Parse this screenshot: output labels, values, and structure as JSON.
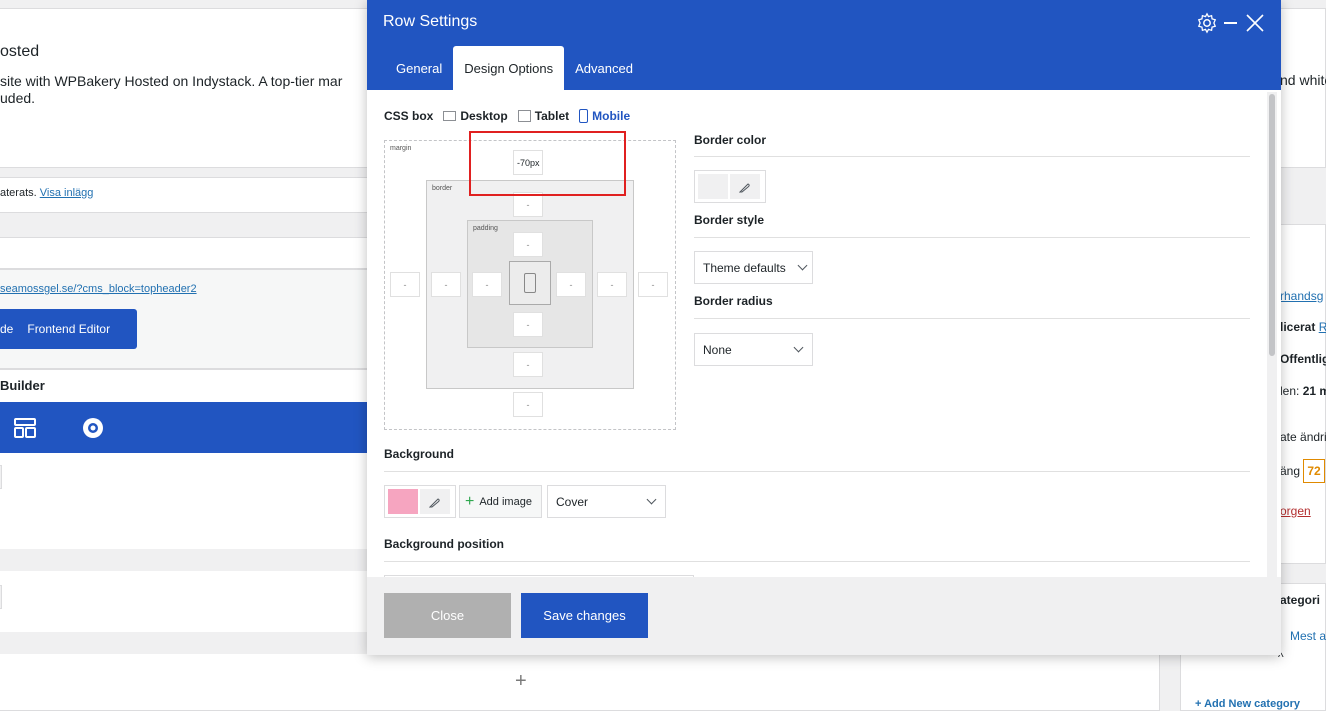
{
  "background": {
    "page_title": "osted",
    "description_line1": "site with WPBakery Hosted on Indystack. A top-tier mar",
    "description_line2": "uded.",
    "notice_text": "aterats.",
    "notice_link": "Visa inlägg",
    "url_link": "seamossgel.se/?cms_block=topheader2",
    "btn_left_label": "de",
    "btn_frontend_label": "Frontend Editor",
    "builder_label": "Builder",
    "add_row_symbol": "+",
    "right_text_top": "nd white",
    "right_items": [
      "rhandsg",
      "licerat",
      "R",
      "Offentlig",
      "len:",
      "21 m",
      "ate ändri",
      "äng",
      "72",
      "orgen",
      "ategori",
      "Mest a",
      "^",
      "+ Add New category"
    ]
  },
  "modal": {
    "title": "Row Settings",
    "tabs": [
      {
        "label": "General"
      },
      {
        "label": "Design Options"
      },
      {
        "label": "Advanced"
      }
    ],
    "css_box": {
      "label": "CSS box",
      "devices": [
        "Desktop",
        "Tablet",
        "Mobile"
      ],
      "margin_label": "margin",
      "border_label": "border",
      "padding_label": "padding",
      "margin_top_value": "-70px",
      "empty": "-"
    },
    "border_color_label": "Border color",
    "border_style_label": "Border style",
    "border_style_value": "Theme defaults",
    "border_radius_label": "Border radius",
    "border_radius_value": "None",
    "background_label": "Background",
    "background_color": "#f6a5c0",
    "add_image_label": "Add image",
    "background_size_value": "Cover",
    "background_position_label": "Background position",
    "close_label": "Close",
    "save_label": "Save changes"
  },
  "colors": {
    "primary": "#2155c1",
    "highlight": "#e02020",
    "close_btn": "#b0b0b0"
  }
}
